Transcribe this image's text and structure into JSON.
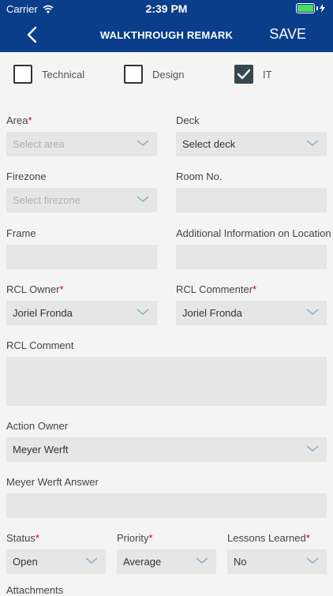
{
  "status_bar": {
    "carrier": "Carrier",
    "time": "2:39 PM"
  },
  "nav": {
    "title": "WALKTHROUGH REMARK",
    "save_label": "SAVE"
  },
  "categories": [
    {
      "label": "Technical",
      "checked": false
    },
    {
      "label": "Design",
      "checked": false
    },
    {
      "label": "IT",
      "checked": true
    }
  ],
  "fields": {
    "area": {
      "label": "Area",
      "required": "*",
      "placeholder": "Select area"
    },
    "deck": {
      "label": "Deck",
      "value": "Select deck"
    },
    "firezone": {
      "label": "Firezone",
      "placeholder": "Select firezone"
    },
    "room_no": {
      "label": "Room No.",
      "value": ""
    },
    "frame": {
      "label": "Frame",
      "value": ""
    },
    "additional_info": {
      "label": "Additional Information on Location",
      "value": ""
    },
    "rcl_owner": {
      "label": "RCL Owner",
      "required": "*",
      "value": "Joriel Fronda"
    },
    "rcl_commenter": {
      "label": "RCL Commenter",
      "required": "*",
      "value": "Joriel Fronda"
    },
    "rcl_comment": {
      "label": "RCL Comment",
      "value": ""
    },
    "action_owner": {
      "label": "Action Owner",
      "value": "Meyer Werft"
    },
    "meyer_answer": {
      "label": "Meyer Werft Answer",
      "value": ""
    },
    "status": {
      "label": "Status",
      "required": "*",
      "value": "Open"
    },
    "priority": {
      "label": "Priority",
      "required": "*",
      "value": "Average"
    },
    "lessons_learned": {
      "label": "Lessons Learned",
      "required": "*",
      "value": "No"
    },
    "attachments": {
      "label": "Attachments"
    }
  },
  "colors": {
    "nav": "#0a3d8a",
    "checkbox_checked": "#37474f",
    "required": "#d0021b",
    "chevron": "#8fb4c9"
  }
}
